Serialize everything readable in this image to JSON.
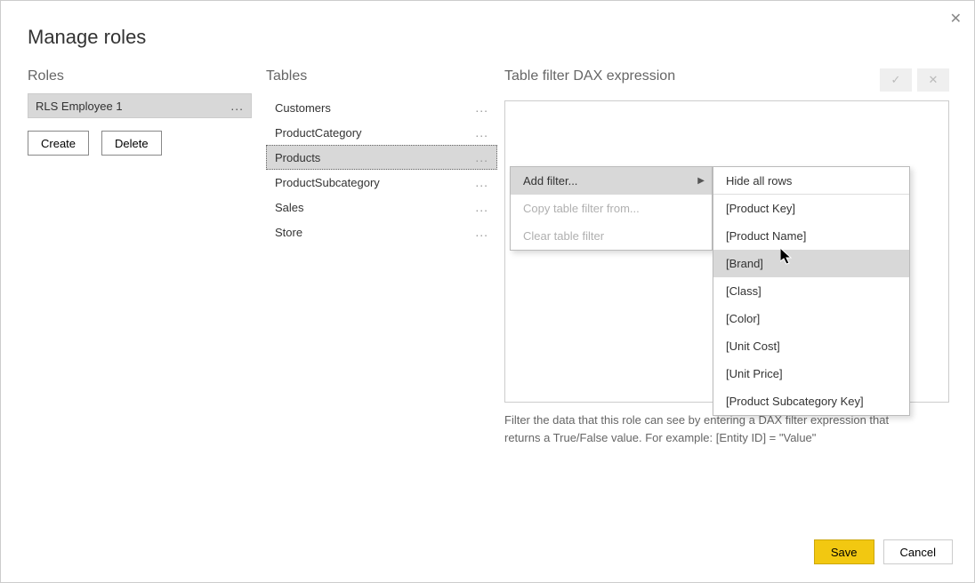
{
  "dialog": {
    "title": "Manage roles",
    "close_icon": "✕"
  },
  "roles_section": {
    "heading": "Roles",
    "items": [
      {
        "label": "RLS Employee 1",
        "selected": true
      }
    ],
    "create_label": "Create",
    "delete_label": "Delete"
  },
  "tables_section": {
    "heading": "Tables",
    "items": [
      {
        "label": "Customers",
        "selected": false
      },
      {
        "label": "ProductCategory",
        "selected": false
      },
      {
        "label": "Products",
        "selected": true
      },
      {
        "label": "ProductSubcategory",
        "selected": false
      },
      {
        "label": "Sales",
        "selected": false
      },
      {
        "label": "Store",
        "selected": false
      }
    ]
  },
  "expression_section": {
    "heading": "Table filter DAX expression",
    "validate_icon": "✓",
    "revert_icon": "✕",
    "hint": "Filter the data that this role can see by entering a DAX filter expression that returns a True/False value. For example: [Entity ID] = \"Value\""
  },
  "context_menu": {
    "items": [
      {
        "label": "Add filter...",
        "has_submenu": true,
        "enabled": true,
        "highlighted": true
      },
      {
        "label": "Copy table filter from...",
        "has_submenu": false,
        "enabled": false,
        "highlighted": false
      },
      {
        "label": "Clear table filter",
        "has_submenu": false,
        "enabled": false,
        "highlighted": false
      }
    ]
  },
  "submenu": {
    "items": [
      {
        "label": "Hide all rows",
        "highlighted": false,
        "divider_after": true
      },
      {
        "label": "[Product Key]",
        "highlighted": false
      },
      {
        "label": "[Product Name]",
        "highlighted": false
      },
      {
        "label": "[Brand]",
        "highlighted": true
      },
      {
        "label": "[Class]",
        "highlighted": false
      },
      {
        "label": "[Color]",
        "highlighted": false
      },
      {
        "label": "[Unit Cost]",
        "highlighted": false
      },
      {
        "label": "[Unit Price]",
        "highlighted": false
      },
      {
        "label": "[Product Subcategory Key]",
        "highlighted": false
      }
    ]
  },
  "footer": {
    "save_label": "Save",
    "cancel_label": "Cancel"
  }
}
